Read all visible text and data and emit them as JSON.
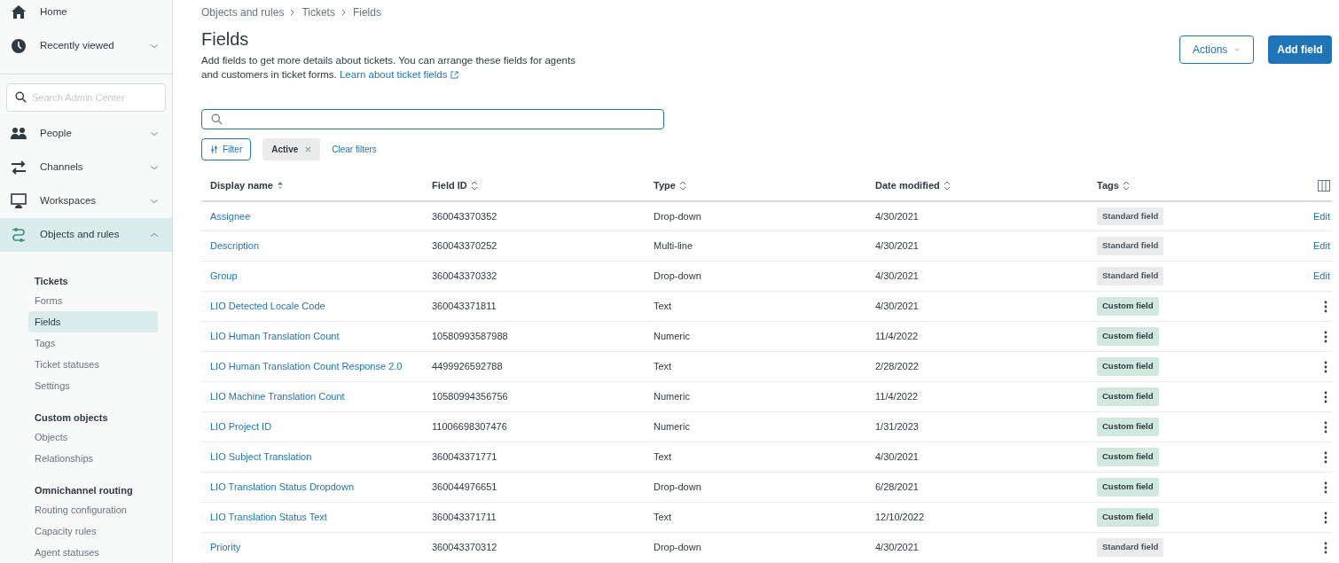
{
  "sidebar": {
    "top_items": [
      {
        "label": "Home",
        "expandable": false
      },
      {
        "label": "Recently viewed",
        "expandable": true
      }
    ],
    "search": {
      "placeholder": "Search Admin Center"
    },
    "nav_items": [
      {
        "label": "People",
        "expanded": false,
        "selected": false
      },
      {
        "label": "Channels",
        "expanded": false,
        "selected": false
      },
      {
        "label": "Workspaces",
        "expanded": false,
        "selected": false
      },
      {
        "label": "Objects and rules",
        "expanded": true,
        "selected": true
      }
    ],
    "sections": [
      {
        "heading": "Tickets",
        "items": [
          {
            "label": "Forms",
            "selected": false
          },
          {
            "label": "Fields",
            "selected": true
          },
          {
            "label": "Tags",
            "selected": false
          },
          {
            "label": "Ticket statuses",
            "selected": false
          },
          {
            "label": "Settings",
            "selected": false
          }
        ]
      },
      {
        "heading": "Custom objects",
        "items": [
          {
            "label": "Objects",
            "selected": false
          },
          {
            "label": "Relationships",
            "selected": false
          }
        ]
      },
      {
        "heading": "Omnichannel routing",
        "items": [
          {
            "label": "Routing configuration",
            "selected": false
          },
          {
            "label": "Capacity rules",
            "selected": false
          },
          {
            "label": "Agent statuses",
            "selected": false
          }
        ]
      }
    ]
  },
  "breadcrumb": [
    "Objects and rules",
    "Tickets",
    "Fields"
  ],
  "title": "Fields",
  "description": "Add fields to get more details about tickets. You can arrange these fields for agents and customers in ticket forms.",
  "learn_link": "Learn about ticket fields",
  "actions_button": "Actions",
  "add_button": "Add field",
  "filter_button": "Filter",
  "active_filter": "Active",
  "clear_filters": "Clear filters",
  "table": {
    "columns": [
      {
        "label": "Display name",
        "sorted": true
      },
      {
        "label": "Field ID",
        "sorted": false
      },
      {
        "label": "Type",
        "sorted": false
      },
      {
        "label": "Date modified",
        "sorted": false
      },
      {
        "label": "Tags",
        "sorted": false
      }
    ],
    "rows": [
      {
        "kind": "edit",
        "name": "Assignee",
        "id": "360043370352",
        "type": "Drop-down",
        "date": "4/30/2021",
        "tag": {
          "kind": "standard",
          "label": "Standard field"
        },
        "action": "Edit"
      },
      {
        "kind": "edit",
        "name": "Description",
        "id": "360043370252",
        "type": "Multi-line",
        "date": "4/30/2021",
        "tag": {
          "kind": "standard",
          "label": "Standard field"
        },
        "action": "Edit"
      },
      {
        "kind": "edit",
        "name": "Group",
        "id": "360043370332",
        "type": "Drop-down",
        "date": "4/30/2021",
        "tag": {
          "kind": "standard",
          "label": "Standard field"
        },
        "action": "Edit"
      },
      {
        "kind": "menu",
        "name": "LIO Detected Locale Code",
        "id": "360043371811",
        "type": "Text",
        "date": "4/30/2021",
        "tag": {
          "kind": "custom",
          "label": "Custom field"
        }
      },
      {
        "kind": "menu",
        "name": "LIO Human Translation Count",
        "id": "10580993587988",
        "type": "Numeric",
        "date": "11/4/2022",
        "tag": {
          "kind": "custom",
          "label": "Custom field"
        }
      },
      {
        "kind": "menu",
        "name": "LIO Human Translation Count Response 2.0",
        "id": "4499926592788",
        "type": "Text",
        "date": "2/28/2022",
        "tag": {
          "kind": "custom",
          "label": "Custom field"
        }
      },
      {
        "kind": "menu",
        "name": "LIO Machine Translation Count",
        "id": "10580994356756",
        "type": "Numeric",
        "date": "11/4/2022",
        "tag": {
          "kind": "custom",
          "label": "Custom field"
        }
      },
      {
        "kind": "menu",
        "name": "LIO Project ID",
        "id": "11006698307476",
        "type": "Numeric",
        "date": "1/31/2023",
        "tag": {
          "kind": "custom",
          "label": "Custom field"
        }
      },
      {
        "kind": "menu",
        "name": "LIO Subject Translation",
        "id": "360043371771",
        "type": "Text",
        "date": "4/30/2021",
        "tag": {
          "kind": "custom",
          "label": "Custom field"
        }
      },
      {
        "kind": "menu",
        "name": "LIO Translation Status Dropdown",
        "id": "360044976651",
        "type": "Drop-down",
        "date": "6/28/2021",
        "tag": {
          "kind": "custom",
          "label": "Custom field"
        }
      },
      {
        "kind": "menu",
        "name": "LIO Translation Status Text",
        "id": "360043371711",
        "type": "Text",
        "date": "12/10/2022",
        "tag": {
          "kind": "custom",
          "label": "Custom field"
        }
      },
      {
        "kind": "menu",
        "name": "Priority",
        "id": "360043370312",
        "type": "Drop-down",
        "date": "4/30/2021",
        "tag": {
          "kind": "standard",
          "label": "Standard field"
        }
      }
    ]
  }
}
